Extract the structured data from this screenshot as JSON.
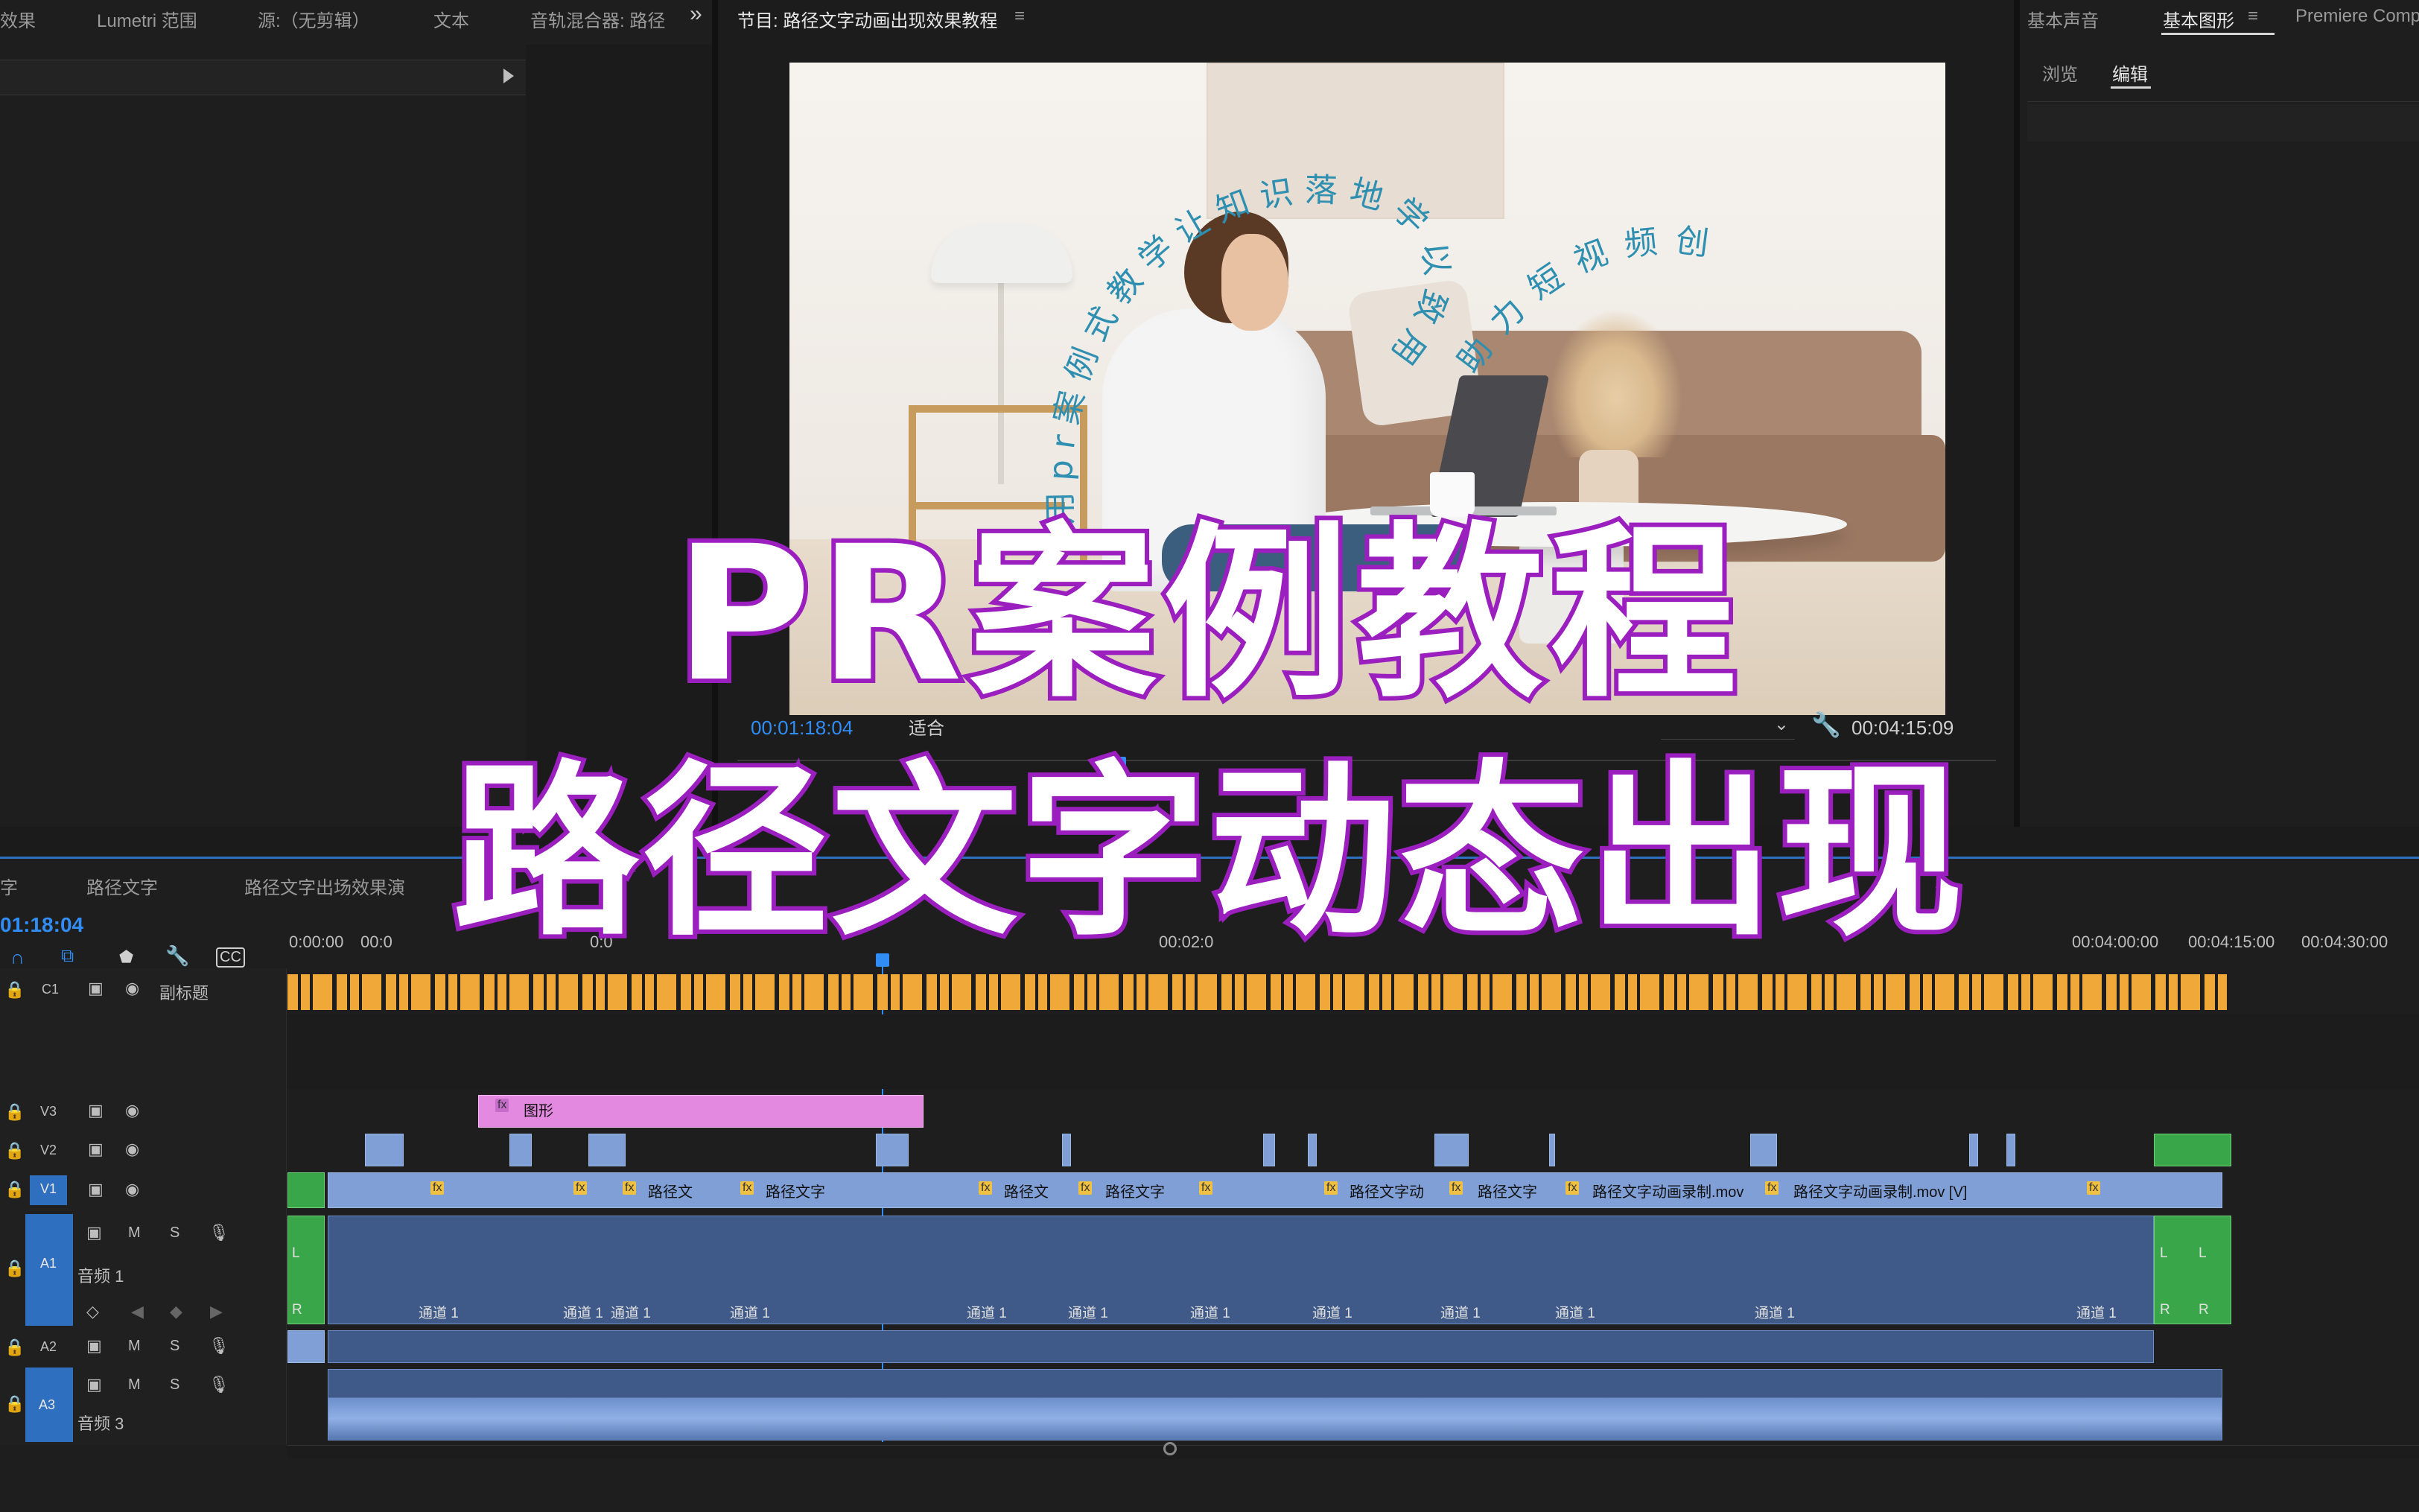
{
  "top_tabs_left": [
    "效果",
    "Lumetri 范围",
    "源:（无剪辑）",
    "文本",
    "音轨混合器: 路径"
  ],
  "program": {
    "title": "节目: 路径文字动画出现效果教程",
    "timecode_current": "00:01:18:04",
    "fit_label": "适合",
    "duration": "00:04:15:09",
    "curve_text_1": "用pr案例式教学让知识落地学以致用",
    "curve_text_2": "助力短视频创作"
  },
  "right_panel": {
    "tabs": [
      "基本声音",
      "基本图形",
      "Premiere Compo"
    ],
    "sub_tabs": [
      "浏览",
      "编辑"
    ]
  },
  "overlay": {
    "line1": "PR案例教程",
    "line2": "路径文字动态出现"
  },
  "timeline": {
    "tabs": [
      "字",
      "路径文字",
      "路径文字出场效果演"
    ],
    "timecode": "01:18:04",
    "ruler": [
      "0:00:00",
      "00:0",
      "0:0",
      "00:02:0",
      "00:04:00:00",
      "00:04:15:00",
      "00:04:30:00"
    ],
    "tracks": {
      "c1": {
        "id": "C1",
        "name": "副标题"
      },
      "v3": {
        "id": "V3"
      },
      "v2": {
        "id": "V2"
      },
      "v1": {
        "id": "V1"
      },
      "a1": {
        "id": "A1",
        "name": "音频 1"
      },
      "a2": {
        "id": "A2"
      },
      "a3": {
        "id": "A3",
        "name": "音频 3"
      }
    },
    "graphic_clip": "图形",
    "v1_clips": [
      "路径文",
      "路径文字",
      "路径文",
      "路径文字",
      "路径文字动",
      "路径文字",
      "路径文字动画录制.mov",
      "路径文字动画录制.mov [V]"
    ],
    "channel_label": "通道 1",
    "mute": "M",
    "solo": "S",
    "lr": [
      "L",
      "R"
    ],
    "fx": "fx"
  },
  "colors": {
    "accent": "#2f8df5",
    "graphic_clip": "#e38ae0",
    "video_clip": "#7f9fd6",
    "audio_clip": "#3f5a88",
    "caption_clip": "#f0a838",
    "overlay_stroke": "#9b1fbf"
  }
}
